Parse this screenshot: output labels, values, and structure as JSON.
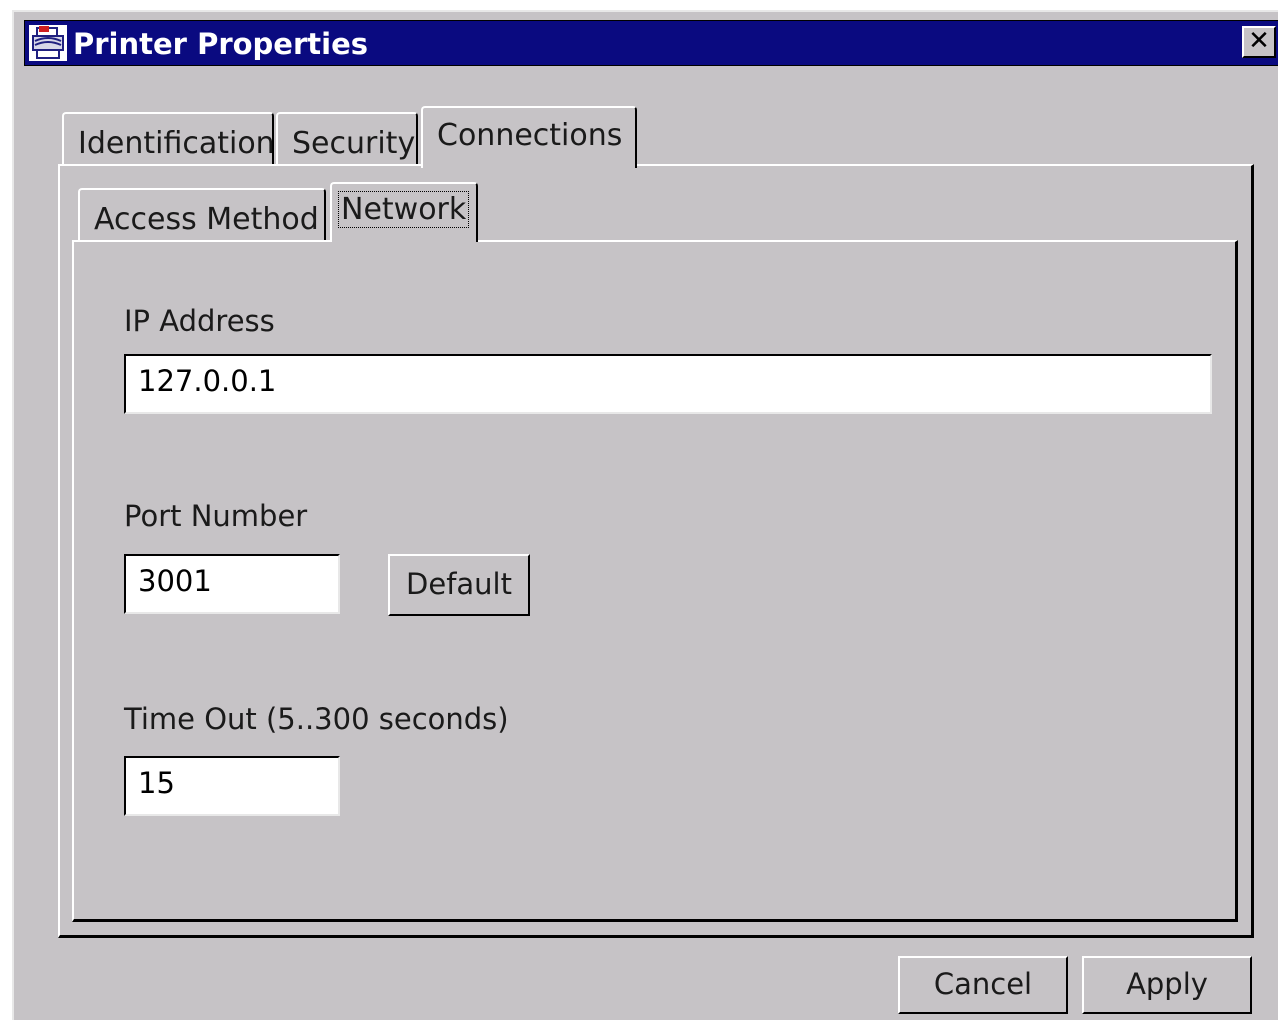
{
  "window": {
    "title": "Printer Properties",
    "close_glyph": "✕"
  },
  "tabs": {
    "primary": [
      {
        "label": "Identification",
        "selected": false
      },
      {
        "label": "Security",
        "selected": false
      },
      {
        "label": "Connections",
        "selected": true
      }
    ],
    "secondary": [
      {
        "label": "Access Method",
        "selected": false
      },
      {
        "label": "Network",
        "selected": true
      }
    ]
  },
  "form": {
    "ip_label": "IP Address",
    "ip_value": "127.0.0.1",
    "port_label": "Port Number",
    "port_value": "3001",
    "default_label": "Default",
    "timeout_label": "Time Out (5..300 seconds)",
    "timeout_value": "15"
  },
  "footer": {
    "cancel_label": "Cancel",
    "apply_label": "Apply"
  },
  "icons": {
    "window_icon": "printer-icon",
    "close_icon": "close-icon"
  },
  "colors": {
    "titlebar": "#0a0a80",
    "face": "#c6c3c6",
    "field": "#ffffff"
  }
}
